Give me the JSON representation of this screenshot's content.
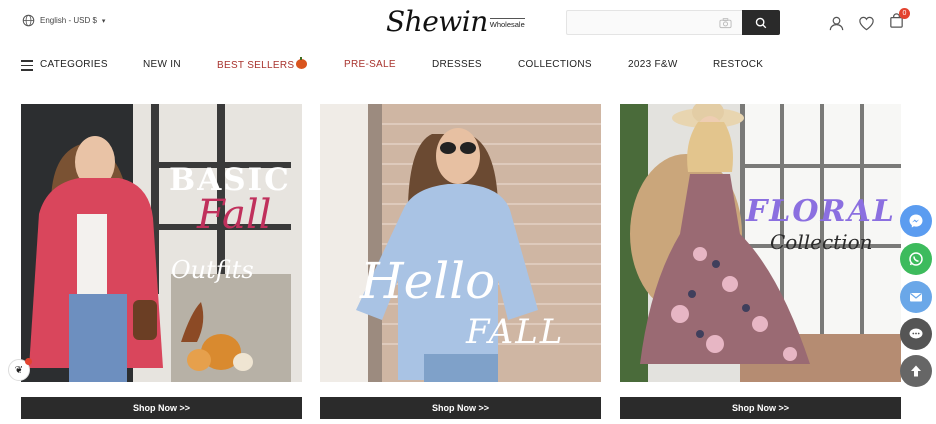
{
  "header": {
    "locale": "English - USD $",
    "logo_main": "Shewin",
    "logo_sub": "Wholesale",
    "search_placeholder": "",
    "cart_count": "0"
  },
  "nav": {
    "categories": "CATEGORIES",
    "items": [
      {
        "label": "NEW IN"
      },
      {
        "label": "BEST SELLERS"
      },
      {
        "label": "PRE-SALE"
      },
      {
        "label": "DRESSES"
      },
      {
        "label": "COLLECTIONS"
      },
      {
        "label": "2023 F&W"
      },
      {
        "label": "RESTOCK"
      }
    ]
  },
  "banners": [
    {
      "line1": "BASIC",
      "line2": "Fall",
      "line3": "Outfits",
      "button": "Shop Now >>"
    },
    {
      "line1": "Hello",
      "line2": "FALL",
      "button": "Shop Now >>"
    },
    {
      "line1": "FLORAL",
      "line2": "Collection",
      "button": "Shop Now >>"
    }
  ],
  "colors": {
    "accent_red": "#a8332d",
    "floral_purple": "#8b6fe0",
    "button_dark": "#2b2b2b",
    "messenger": "#5b9cf0",
    "whatsapp": "#3dbb5d"
  },
  "floating": {
    "icons": [
      "messenger-icon",
      "whatsapp-icon",
      "email-icon",
      "chat-icon",
      "scroll-top-icon"
    ]
  }
}
